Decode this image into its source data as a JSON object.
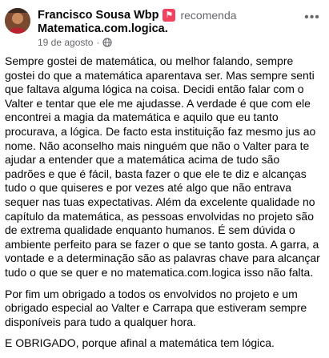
{
  "post": {
    "author": "Francisco Sousa Wbp",
    "verb": "recomenda",
    "page": "Matematica.com.logica",
    "page_suffix": ".",
    "date": "19 de agosto",
    "separator": "·",
    "icons": {
      "recommend": "recommend-badge-icon",
      "audience": "globe-icon",
      "options": "more-options-icon"
    },
    "colors": {
      "badge": "#f3425f",
      "muted": "#65676b",
      "text": "#050505"
    },
    "paragraphs": [
      "Sempre gostei de matemática, ou melhor falando, sempre gostei do que a matemática aparentava ser. Mas sempre senti que faltava alguma lógica na coisa. Decidi então falar com o Valter e tentar que ele me ajudasse. A verdade é que com ele encontrei a magia da matemática e aquilo que eu tanto procurava, a lógica. De facto esta instituição faz mesmo jus ao nome. Não aconselho mais ninguém que não o Valter para te ajudar a entender que a matemática acima de tudo são padrões e que é fácil, basta fazer o que ele te diz e alcanças tudo o que quiseres e por vezes até algo que não entrava sequer nas tuas expectativas. Além da excelente qualidade no capítulo da matemática, as pessoas envolvidas no projeto são de extrema qualidade enquanto humanos. É sem dúvida o ambiente perfeito para se fazer o que se tanto gosta. A garra, a vontade e a determinação são as palavras chave para alcançar tudo o que se quer e no matematica.com.logica isso não falta.",
      "Por fim um obrigado a todos os envolvidos no projeto e um obrigado especial ao Valter e Carrapa que estiveram sempre disponíveis para tudo a qualquer hora.",
      "E OBRIGADO, porque afinal a matemática tem lógica."
    ]
  }
}
